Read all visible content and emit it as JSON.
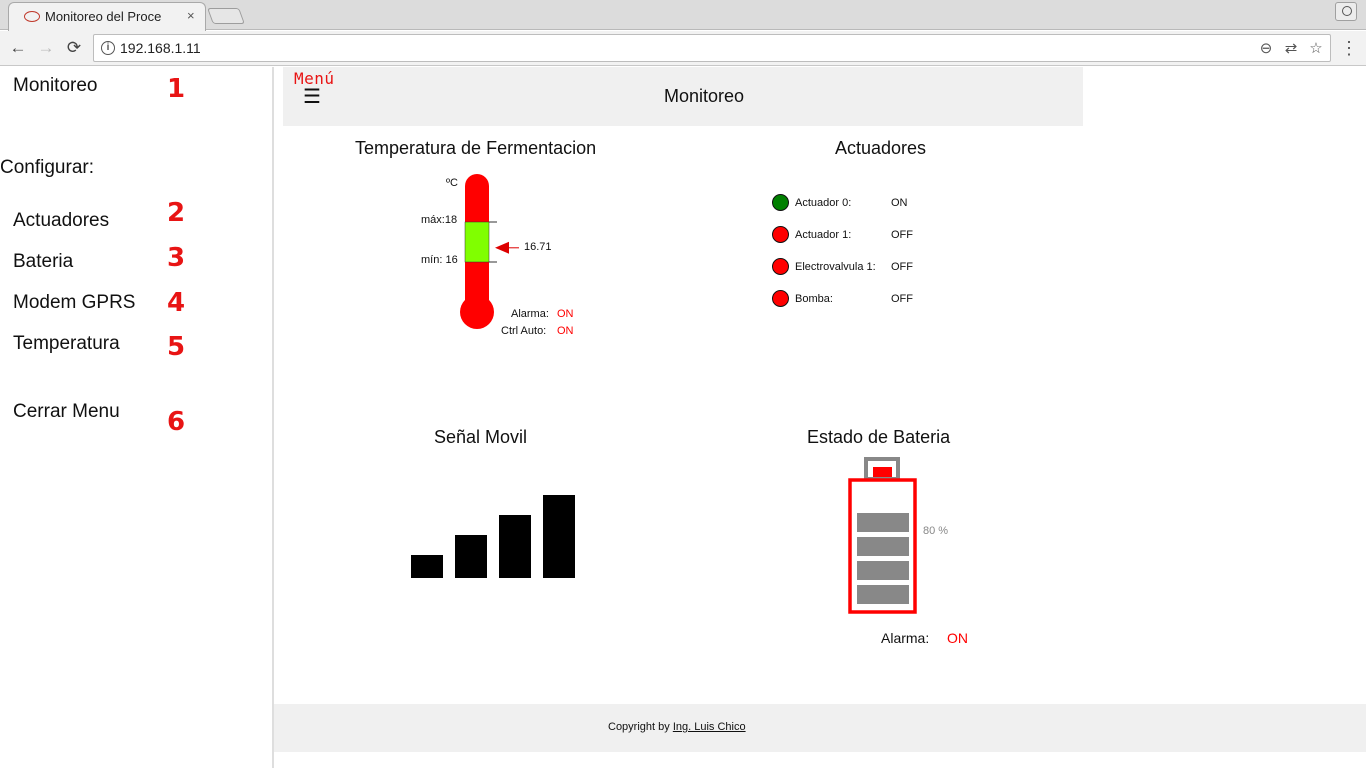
{
  "browser": {
    "tab_title": "Monitoreo del Proce",
    "tab_close": "×",
    "url": "192.168.1.11",
    "back_glyph": "←",
    "forward_glyph": "→",
    "reload_glyph": "⟳",
    "info_glyph": "i",
    "zoom_glyph": "⊖",
    "translate_glyph": "⇄",
    "star_glyph": "☆",
    "menu_glyph": "⋮"
  },
  "sidebar": {
    "monitoreo": "Monitoreo",
    "configurar": "Configurar:",
    "items": [
      {
        "label": "Actuadores"
      },
      {
        "label": "Bateria"
      },
      {
        "label": "Modem GPRS"
      },
      {
        "label": "Temperatura"
      }
    ],
    "cerrar": "Cerrar Menu",
    "numbers": [
      "1",
      "2",
      "3",
      "4",
      "5",
      "6"
    ]
  },
  "header": {
    "menu_label": "Menú",
    "hamburger": "☰",
    "title": "Monitoreo"
  },
  "temperature": {
    "title": "Temperatura de Fermentacion",
    "unit": "ºC",
    "max_label": "máx:18",
    "min_label": "mín: 16",
    "max": 18,
    "min": 16,
    "current": 16.71,
    "current_label": "16.71",
    "alarm_label": "Alarma:",
    "alarm_value": "ON",
    "ctrl_label": "Ctrl Auto:",
    "ctrl_value": "ON",
    "colors": {
      "tube": "#ff0000",
      "band": "#80ff00",
      "status": "#ff0000"
    }
  },
  "actuators": {
    "title": "Actuadores",
    "rows": [
      {
        "name": "Actuador 0:",
        "state": "ON",
        "color": "#008000"
      },
      {
        "name": "Actuador 1:",
        "state": "OFF",
        "color": "#ff0000"
      },
      {
        "name": "Electrovalvula 1:",
        "state": "OFF",
        "color": "#ff0000"
      },
      {
        "name": "Bomba:",
        "state": "OFF",
        "color": "#ff0000"
      }
    ]
  },
  "signal": {
    "title": "Señal Movil",
    "bars_total": 4,
    "bars_active": 4
  },
  "battery": {
    "title": "Estado de Bateria",
    "level_label": "80 %",
    "level": 0.8,
    "segments_total": 5,
    "segments_filled": 4,
    "alarm_label": "Alarma:",
    "alarm_value": "ON",
    "colors": {
      "outline": "#ff0000",
      "segment": "#888888"
    }
  },
  "footer": {
    "copyright_prefix": "Copyright by ",
    "author": "Ing. Luis Chico"
  }
}
